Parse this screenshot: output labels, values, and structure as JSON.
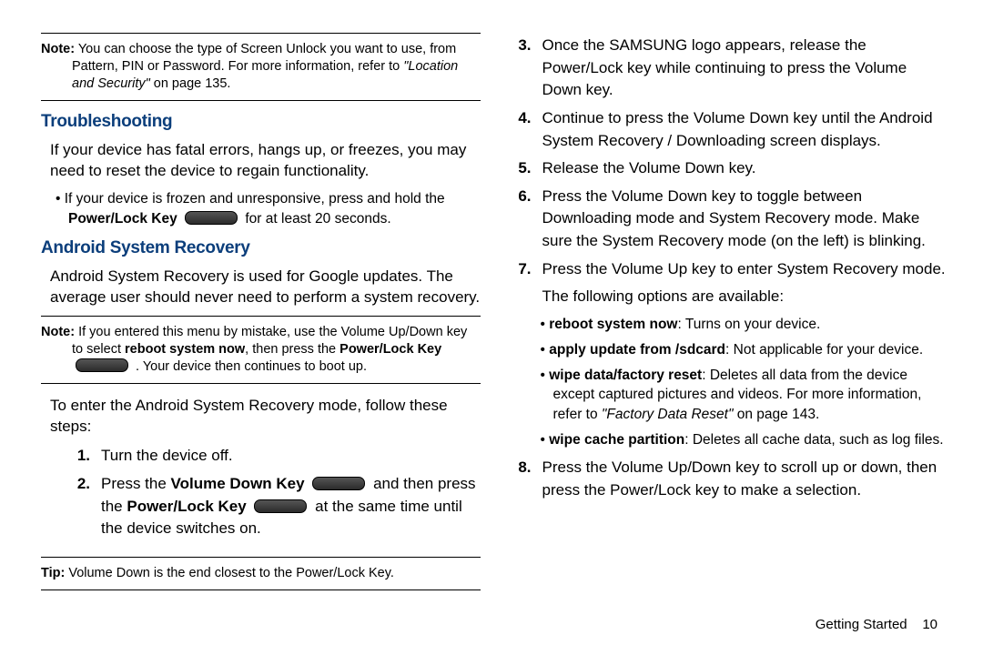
{
  "note1": {
    "lead": "Note:",
    "line1": " You can choose the type of Screen Unlock you want to use, from Pattern, PIN or Password. For more information, refer to ",
    "ref": "\"Location and Security\"",
    "tail": "  on page 135."
  },
  "troubleshooting": {
    "title": "Troubleshooting",
    "p1": "If your device has fatal errors, hangs up, or freezes, you may need to reset the device to regain functionality.",
    "bullet_pre": "If your device is frozen and unresponsive, press and hold the ",
    "bullet_bold": "Power/Lock Key",
    "bullet_post": " for at least 20 seconds."
  },
  "asr": {
    "title": "Android System Recovery",
    "p1": "Android System Recovery is used for Google updates. The average user should never need to perform a system recovery."
  },
  "note2": {
    "lead": "Note:",
    "line1": " If you entered this menu by mistake, use the Volume Up/Down key to select ",
    "b1": "reboot system now",
    "mid": ", then press the ",
    "b2": "Power/Lock Key",
    "after": " . Your device then continues to boot up."
  },
  "steps_intro": "To enter the Android System Recovery mode, follow these steps:",
  "steps_left": [
    {
      "n": "1.",
      "t": "Turn the device off."
    },
    {
      "n": "2.",
      "pre": "Press the ",
      "b1": "Volume Down Key",
      "mid": " and then press the ",
      "b2": "Power/Lock Key",
      "post": " at the same time until the device switches on."
    }
  ],
  "tip": {
    "lead": "Tip:",
    "t": " Volume Down is the end closest to the Power/Lock Key."
  },
  "steps_right": [
    {
      "n": "3.",
      "t": "Once the SAMSUNG logo appears, release the Power/Lock key while continuing to press the Volume Down key."
    },
    {
      "n": "4.",
      "t": "Continue to press the Volume Down key until the Android System Recovery / Downloading screen displays."
    },
    {
      "n": "5.",
      "t": "Release the Volume Down key."
    },
    {
      "n": "6.",
      "t": "Press the Volume Down key to toggle between Downloading mode and System Recovery mode. Make sure the System Recovery mode (on the left) is blinking."
    },
    {
      "n": "7.",
      "t": "Press the Volume Up key to enter System Recovery mode."
    }
  ],
  "options_intro": "The following options are available:",
  "options": [
    {
      "b": "reboot system now",
      "t": ": Turns on your device."
    },
    {
      "b": "apply update from /sdcard",
      "t": ": Not applicable for your device."
    },
    {
      "b": "wipe data/factory reset",
      "t": ": Deletes all data from the device except captured pictures and videos. For more information, refer to ",
      "ref": "\"Factory Data Reset\"",
      "tail": "  on page 143."
    },
    {
      "b": "wipe cache partition",
      "t": ": Deletes all cache data, such as log files."
    }
  ],
  "step8": {
    "n": "8.",
    "t": "Press the Volume Up/Down key to scroll up or down, then press the Power/Lock key to make a selection."
  },
  "footer": {
    "section": "Getting Started",
    "page": "10"
  }
}
